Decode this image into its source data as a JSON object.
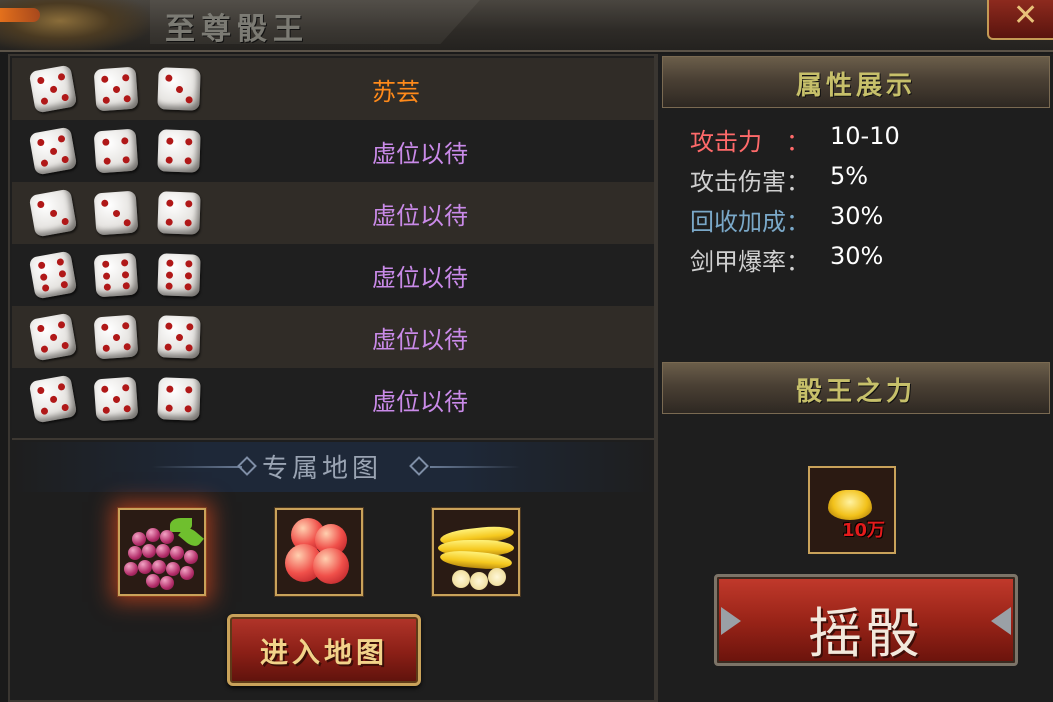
{
  "window": {
    "title": "至尊骰王",
    "close_icon": "close-icon"
  },
  "players": [
    {
      "name": "苏芸",
      "name_color": "#ff8a1a",
      "dice": [
        5,
        5,
        3
      ]
    },
    {
      "name": "虚位以待",
      "name_color": "#c98ae8",
      "dice": [
        5,
        4,
        4
      ]
    },
    {
      "name": "虚位以待",
      "name_color": "#c98ae8",
      "dice": [
        3,
        3,
        4
      ]
    },
    {
      "name": "虚位以待",
      "name_color": "#c98ae8",
      "dice": [
        6,
        6,
        6
      ]
    },
    {
      "name": "虚位以待",
      "name_color": "#c98ae8",
      "dice": [
        5,
        5,
        5
      ]
    },
    {
      "name": "虚位以待",
      "name_color": "#c98ae8",
      "dice": [
        5,
        5,
        4
      ]
    }
  ],
  "exclusive_map": {
    "title": "专属地图",
    "items": [
      "grape-icon",
      "peach-icon",
      "banana-icon"
    ],
    "enter_button": "进入地图"
  },
  "attributes": {
    "header": "属性展示",
    "rows": [
      {
        "label": "攻击力　：",
        "value": "10-10",
        "label_color": "#ff6a6a"
      },
      {
        "label": "攻击伤害：",
        "value": "5%",
        "label_color": "#d0d0d0"
      },
      {
        "label": "回收加成：",
        "value": "30%",
        "label_color": "#7aa8c8"
      },
      {
        "label": "剑甲爆率：",
        "value": "30%",
        "label_color": "#d0d0d0"
      }
    ]
  },
  "dice_king_power": {
    "header": "骰王之力",
    "reward_icon": "gold-ingot-icon",
    "reward_count": "10万",
    "roll_button": "摇骰"
  }
}
